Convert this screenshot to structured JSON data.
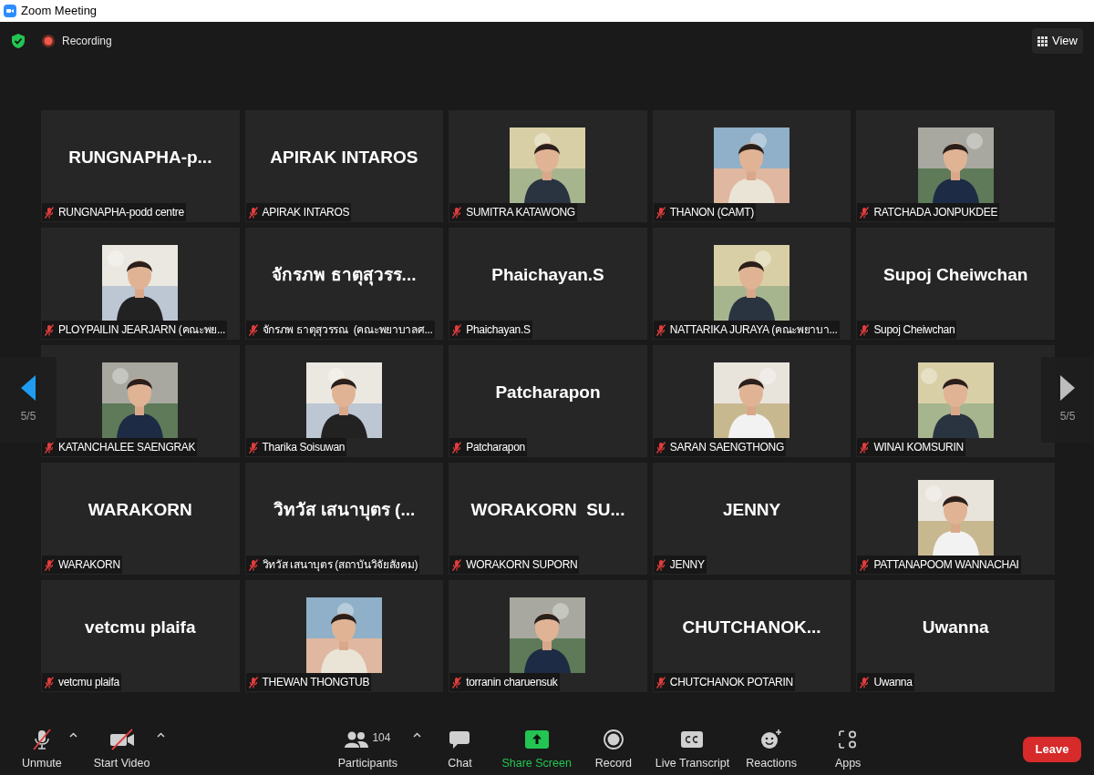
{
  "window": {
    "title": "Zoom Meeting"
  },
  "top_bar": {
    "recording": "Recording",
    "view_button": "View"
  },
  "pager": {
    "left": "5/5",
    "right": "5/5"
  },
  "tiles": [
    {
      "kind": "name",
      "big_name": "RUNGNAPHA-p...",
      "name": "RUNGNAPHA-podd centre",
      "muted": true
    },
    {
      "kind": "name",
      "big_name": "APIRAK INTAROS",
      "name": "APIRAK INTAROS",
      "muted": true
    },
    {
      "kind": "picture",
      "name": "SUMITRA KATAWONG",
      "muted": true
    },
    {
      "kind": "picture",
      "name": "THANON (CAMT)",
      "muted": true
    },
    {
      "kind": "picture",
      "name": "RATCHADA JONPUKDEE",
      "muted": true
    },
    {
      "kind": "picture",
      "name": "PLOYPAILIN JEARJARN (คณะพย...",
      "muted": true
    },
    {
      "kind": "name",
      "big_name": "จักรภพ ธาตุสุวรร...",
      "name": "จักรภพ ธาตุสุวรรณ  (คณะพยาบาลศ...",
      "muted": true
    },
    {
      "kind": "name",
      "big_name": "Phaichayan.S",
      "name": "Phaichayan.S",
      "muted": true
    },
    {
      "kind": "picture",
      "name": "NATTARIKA JURAYA (คณะพยาบา...",
      "muted": true
    },
    {
      "kind": "name",
      "big_name": "Supoj Cheiwchan",
      "name": "Supoj Cheiwchan",
      "muted": true
    },
    {
      "kind": "picture",
      "name": "KATANCHALEE SAENGRAK",
      "muted": true
    },
    {
      "kind": "picture",
      "name": "Tharika Soisuwan",
      "muted": true
    },
    {
      "kind": "name",
      "big_name": "Patcharapon",
      "name": "Patcharapon",
      "muted": true
    },
    {
      "kind": "picture",
      "name": "SARAN SAENGTHONG",
      "muted": true
    },
    {
      "kind": "picture",
      "name": "WINAI KOMSURIN",
      "muted": true
    },
    {
      "kind": "name",
      "big_name": "WARAKORN",
      "name": "WARAKORN",
      "muted": true
    },
    {
      "kind": "name",
      "big_name": "วิทวัส เสนาบุตร (...",
      "name": "วิทวัส เสนาบุตร (สถาบันวิจัยสังคม)",
      "muted": true
    },
    {
      "kind": "name",
      "big_name": "WORAKORN  SU...",
      "name": "WORAKORN SUPORN",
      "muted": true
    },
    {
      "kind": "name",
      "big_name": "JENNY",
      "name": "JENNY",
      "muted": true
    },
    {
      "kind": "picture",
      "name": "PATTANAPOOM WANNACHAI",
      "muted": true
    },
    {
      "kind": "name",
      "big_name": "vetcmu plaifa",
      "name": "vetcmu plaifa",
      "muted": true
    },
    {
      "kind": "picture",
      "name": "THEWAN THONGTUB",
      "muted": true
    },
    {
      "kind": "picture",
      "name": "torranin charuensuk",
      "muted": true
    },
    {
      "kind": "name",
      "big_name": "CHUTCHANOK...",
      "name": "CHUTCHANOK POTARIN",
      "muted": true
    },
    {
      "kind": "name",
      "big_name": "Uwanna",
      "name": "Uwanna",
      "muted": true
    }
  ],
  "toolbar": [
    {
      "kind": "mic",
      "label": "Unmute",
      "off": true,
      "menu": true
    },
    {
      "kind": "video",
      "label": "Start Video",
      "off": true,
      "menu": true
    },
    {
      "kind": "participants",
      "label": "Participants",
      "count": "104",
      "menu": true
    },
    {
      "kind": "chat",
      "label": "Chat"
    },
    {
      "kind": "share",
      "label": "Share Screen",
      "highlighted": true
    },
    {
      "kind": "record",
      "label": "Record"
    },
    {
      "kind": "cc",
      "label": "Live Transcript"
    },
    {
      "kind": "reactions",
      "label": "Reactions"
    },
    {
      "kind": "apps",
      "label": "Apps"
    }
  ],
  "leave_button": "Leave"
}
